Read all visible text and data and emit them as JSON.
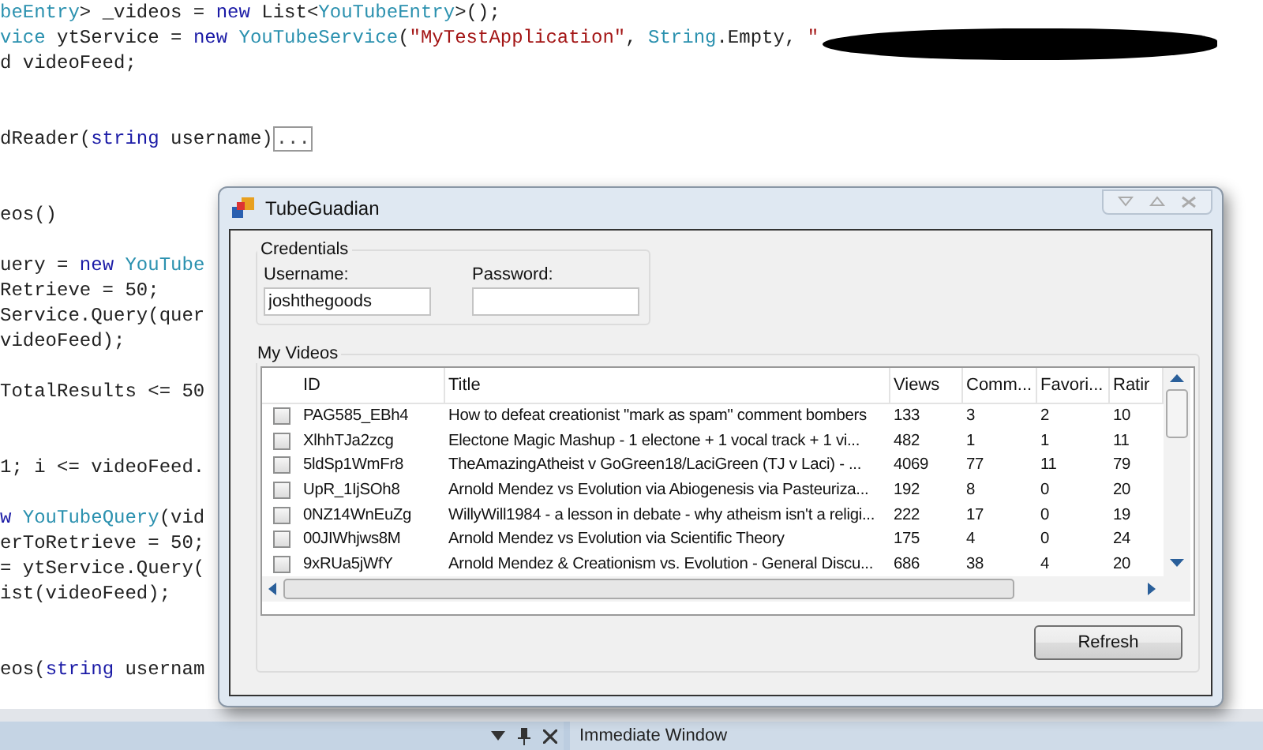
{
  "code_lines": [
    {
      "kind": "code",
      "segments": [
        {
          "kind": "type",
          "text": "beEntry"
        },
        {
          "kind": "plain",
          "text": "> _videos = "
        },
        {
          "kind": "keyword",
          "text": "new"
        },
        {
          "kind": "plain",
          "text": " List<"
        },
        {
          "kind": "type",
          "text": "YouTubeEntry"
        },
        {
          "kind": "plain",
          "text": ">();"
        }
      ]
    },
    {
      "kind": "code",
      "segments": [
        {
          "kind": "type",
          "text": "vice"
        },
        {
          "kind": "plain",
          "text": " ytService = "
        },
        {
          "kind": "keyword",
          "text": "new"
        },
        {
          "kind": "type",
          "text": " YouTubeService"
        },
        {
          "kind": "plain",
          "text": "("
        },
        {
          "kind": "string",
          "text": "\"MyTestApplication\""
        },
        {
          "kind": "plain",
          "text": ", "
        },
        {
          "kind": "type",
          "text": "String"
        },
        {
          "kind": "plain",
          "text": ".Empty, "
        },
        {
          "kind": "string",
          "text": "\""
        },
        {
          "kind": "redacted"
        }
      ]
    },
    {
      "kind": "code",
      "segments": [
        {
          "kind": "plain",
          "text": "d videoFeed;"
        }
      ]
    },
    {
      "kind": "blank"
    },
    {
      "kind": "blank"
    },
    {
      "kind": "code",
      "segments": [
        {
          "kind": "plain",
          "text": "dReader("
        },
        {
          "kind": "keyword",
          "text": "string"
        },
        {
          "kind": "plain",
          "text": " username)"
        },
        {
          "kind": "collapsed",
          "text": "..."
        }
      ]
    },
    {
      "kind": "blank"
    },
    {
      "kind": "blank"
    },
    {
      "kind": "code",
      "segments": [
        {
          "kind": "plain",
          "text": "eos()"
        }
      ]
    },
    {
      "kind": "blank"
    },
    {
      "kind": "code",
      "segments": [
        {
          "kind": "plain",
          "text": "uery = "
        },
        {
          "kind": "keyword",
          "text": "new"
        },
        {
          "kind": "type",
          "text": " YouTube"
        }
      ]
    },
    {
      "kind": "code",
      "segments": [
        {
          "kind": "plain",
          "text": "Retrieve = 50;"
        }
      ]
    },
    {
      "kind": "code",
      "segments": [
        {
          "kind": "plain",
          "text": "Service.Query(quer"
        }
      ]
    },
    {
      "kind": "code",
      "segments": [
        {
          "kind": "plain",
          "text": "videoFeed);"
        }
      ]
    },
    {
      "kind": "blank"
    },
    {
      "kind": "code",
      "segments": [
        {
          "kind": "plain",
          "text": "TotalResults <= 50"
        }
      ]
    },
    {
      "kind": "blank"
    },
    {
      "kind": "blank"
    },
    {
      "kind": "code",
      "segments": [
        {
          "kind": "plain",
          "text": "1; i <= videoFeed."
        }
      ]
    },
    {
      "kind": "blank"
    },
    {
      "kind": "code",
      "segments": [
        {
          "kind": "keyword",
          "text": "w"
        },
        {
          "kind": "type",
          "text": " YouTubeQuery"
        },
        {
          "kind": "plain",
          "text": "(vid"
        }
      ]
    },
    {
      "kind": "code",
      "segments": [
        {
          "kind": "plain",
          "text": "erToRetrieve = 50;"
        }
      ]
    },
    {
      "kind": "code",
      "segments": [
        {
          "kind": "plain",
          "text": "= ytService.Query("
        }
      ]
    },
    {
      "kind": "code",
      "segments": [
        {
          "kind": "plain",
          "text": "ist(videoFeed);"
        }
      ]
    },
    {
      "kind": "blank"
    },
    {
      "kind": "blank"
    },
    {
      "kind": "code",
      "segments": [
        {
          "kind": "plain",
          "text": "eos("
        },
        {
          "kind": "keyword",
          "text": "string"
        },
        {
          "kind": "plain",
          "text": " usernam"
        }
      ]
    }
  ],
  "dialog": {
    "title": "TubeGuadian",
    "credentials": {
      "legend": "Credentials",
      "username_label": "Username:",
      "username": "joshthegoods",
      "password_label": "Password:"
    },
    "videos": {
      "legend": "My Videos",
      "columns": [
        "ID",
        "Title",
        "Views",
        "Comm...",
        "Favori...",
        "Ratir"
      ],
      "rows": [
        {
          "checked": false,
          "cells": [
            "PAG585_EBh4",
            "How to defeat creationist \"mark as spam\" comment bombers",
            "133",
            "3",
            "2",
            "10"
          ]
        },
        {
          "checked": false,
          "cells": [
            "XlhhTJa2zcg",
            "Electone Magic Mashup - 1 electone + 1 vocal track + 1 vi...",
            "482",
            "1",
            "1",
            "11"
          ]
        },
        {
          "checked": false,
          "cells": [
            "5ldSp1WmFr8",
            "TheAmazingAtheist v GoGreen18/LaciGreen (TJ v Laci) - ...",
            "4069",
            "77",
            "11",
            "79"
          ]
        },
        {
          "checked": false,
          "cells": [
            "UpR_1IjSOh8",
            "Arnold Mendez vs Evolution via Abiogenesis via Pasteuriza...",
            "192",
            "8",
            "0",
            "20"
          ]
        },
        {
          "checked": false,
          "cells": [
            "0NZ14WnEuZg",
            "WillyWill1984 - a lesson in debate - why atheism isn't a religi...",
            "222",
            "17",
            "0",
            "19"
          ]
        },
        {
          "checked": false,
          "cells": [
            "00JIWhjws8M",
            "Arnold Mendez vs Evolution via Scientific Theory",
            "175",
            "4",
            "0",
            "24"
          ]
        },
        {
          "checked": false,
          "cells": [
            "9xRUa5jWfY",
            "Arnold Mendez & Creationism vs. Evolution - General Discu...",
            "686",
            "38",
            "4",
            "20"
          ]
        }
      ]
    },
    "refresh_button": "Refresh"
  },
  "bottom_bar": {
    "tab": "Immediate Window"
  }
}
